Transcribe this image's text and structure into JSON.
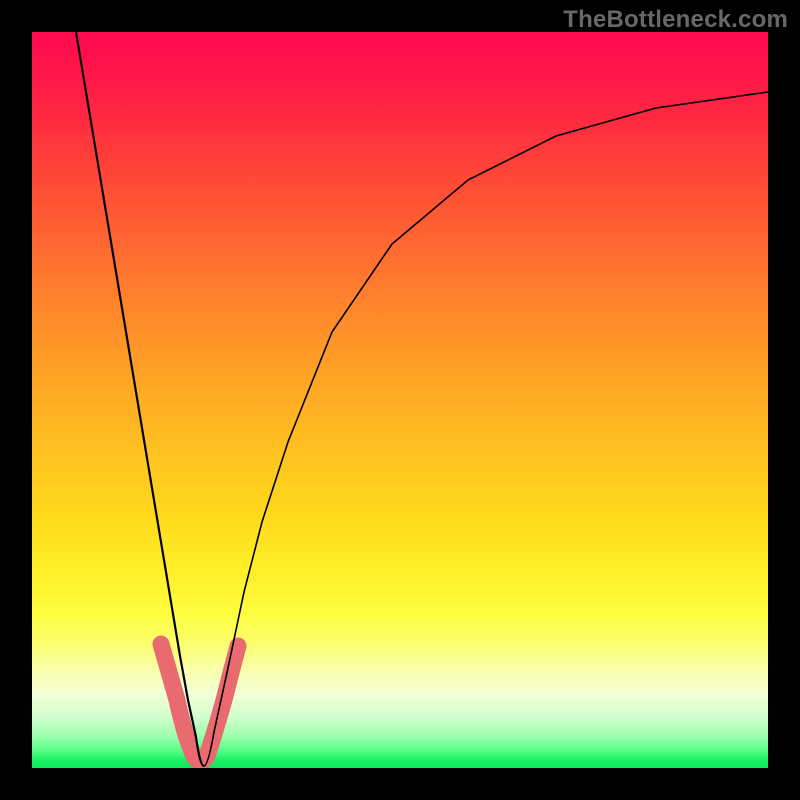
{
  "watermark": "TheBottleneck.com",
  "colors": {
    "frame": "#000000",
    "gradient_top": "#ff0a4f",
    "gradient_bottom": "#0ee85a",
    "marker": "#e96a6f",
    "curve": "#000000",
    "watermark_text": "#68686a"
  },
  "chart_data": {
    "type": "line",
    "title": "",
    "xlabel": "",
    "ylabel": "",
    "xlim": [
      0,
      100
    ],
    "ylim": [
      0,
      100
    ],
    "grid": false,
    "series": [
      {
        "name": "left-branch",
        "x": [
          6,
          8,
          10,
          12,
          14,
          16,
          18,
          19,
          20,
          21,
          22
        ],
        "values": [
          100,
          87,
          74,
          61,
          48,
          35,
          22,
          15,
          10,
          5,
          0
        ]
      },
      {
        "name": "right-branch",
        "x": [
          22,
          24,
          26,
          28,
          30,
          34,
          40,
          48,
          58,
          70,
          84,
          100
        ],
        "values": [
          0,
          10,
          20,
          29,
          37,
          49,
          61,
          71,
          79,
          85,
          89,
          91
        ]
      }
    ],
    "annotations": [
      {
        "name": "highlight-range",
        "type": "segment",
        "color": "#e96a6f",
        "x": [
          18.5,
          19.5,
          20.5,
          21.5,
          22.0,
          22.5,
          23.5,
          24.5,
          25.5
        ],
        "values": [
          18,
          12,
          6,
          2,
          0,
          2,
          6,
          12,
          18
        ]
      }
    ]
  }
}
